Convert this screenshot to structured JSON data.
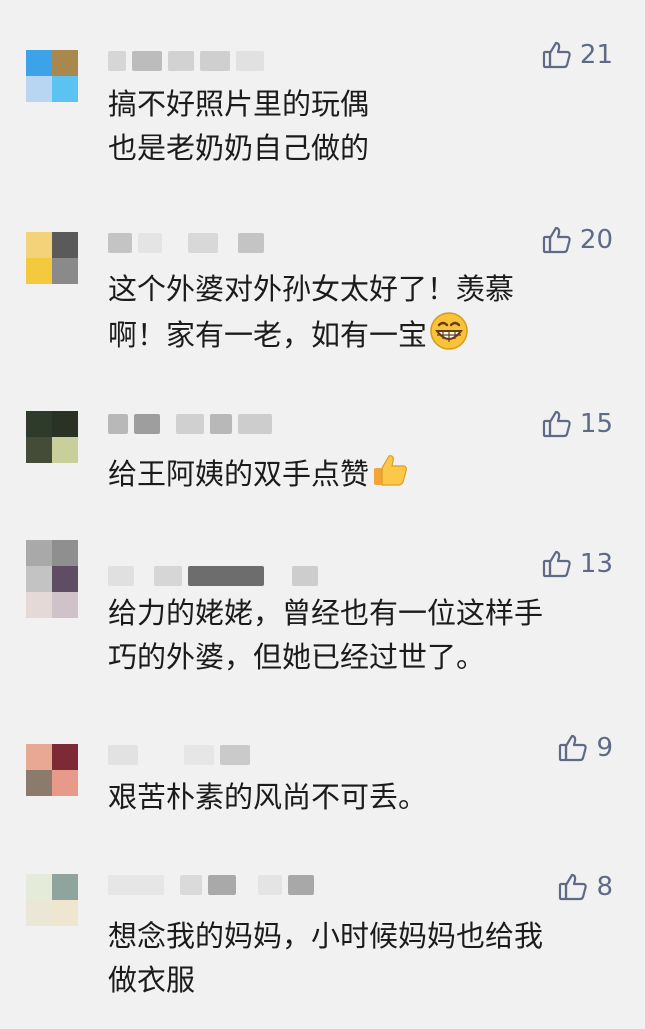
{
  "comments": [
    {
      "avatar_colors": [
        "#3da3e8",
        "#a9884e",
        "#b8d6f2",
        "#5bc3f2"
      ],
      "nick_colors": [
        "#c8c8c8",
        "#b0b0b0",
        "#d8d8d8",
        "#cccccc"
      ],
      "likes": "21",
      "text": "搞不好照片里的玩偶\n也是老奶奶自己做的"
    },
    {
      "avatar_colors": [
        "#f3d27a",
        "#5a5a5a",
        "#f5c93e",
        "#8a8a8a"
      ],
      "nick_colors": [
        "#c0c0c0",
        "#dadada",
        "#bdbdbd"
      ],
      "likes": "20",
      "text": "这个外婆对外孙女太好了！羡慕\n啊！家有一老，如有一宝",
      "emoji": "grinning-face-emoji"
    },
    {
      "avatar_colors": [
        "#2f3b2a",
        "#2a3226",
        "#444b36",
        "#c9cf9a"
      ],
      "nick_colors": [
        "#a5a5a5",
        "#c0c0c0",
        "#b5b5b5",
        "#cfcfcf"
      ],
      "likes": "15",
      "text": "给王阿姨的双手点赞",
      "emoji": "thumbs-up-emoji"
    },
    {
      "avatar_colors": [
        "#a9a9a9",
        "#8f8f8f",
        "#c3c3c3",
        "#5e4d63",
        "#e4d9d6",
        "#cfc2c9"
      ],
      "nick_colors": [
        "#dcdcdc",
        "#c9c9c9",
        "#6d6d6d",
        "#bdbdbd"
      ],
      "likes": "13",
      "text": "给力的姥姥，曾经也有一位这样手\n巧的外婆，但她已经过世了。"
    },
    {
      "avatar_colors": [
        "#e9a894",
        "#7d2a36",
        "#8a7b6d",
        "#e79a89"
      ],
      "nick_colors": [
        "#d6d6d6",
        "#e0e0e0",
        "#bdbdbd"
      ],
      "likes": "9",
      "text": "艰苦朴素的风尚不可丢。"
    },
    {
      "avatar_colors": [
        "#e4ecd9",
        "#8fa49c",
        "#ebe7d6",
        "#efe6cf"
      ],
      "nick_colors": [
        "#e3e3e3",
        "#cfcfcf",
        "#a3a3a3",
        "#c4c4c4"
      ],
      "likes": "8",
      "text": "想念我的妈妈，小时候妈妈也给我\n做衣服"
    }
  ]
}
